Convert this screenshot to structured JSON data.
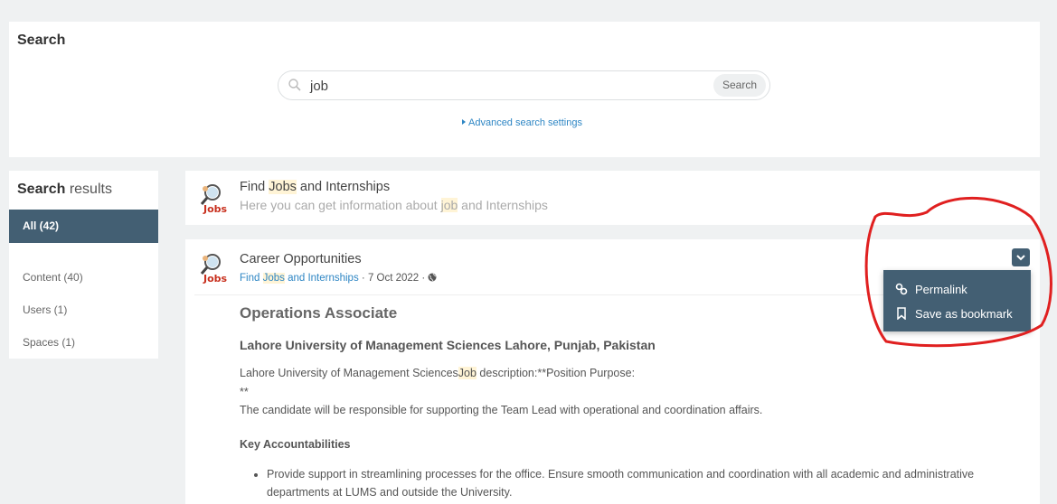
{
  "search": {
    "title": "Search",
    "query": "job",
    "button_label": "Search",
    "advanced_link": "Advanced search settings"
  },
  "sidebar": {
    "title_bold": "Search",
    "title_rest": " results",
    "active_filter": "All (42)",
    "filters": [
      "Content (40)",
      "Users (1)",
      "Spaces (1)"
    ]
  },
  "results": [
    {
      "title_pre": "Find ",
      "title_hl": "Jobs",
      "title_post": " and Internships",
      "sub_pre": "Here you can get information about ",
      "sub_hl": "job",
      "sub_post": " and Internships"
    },
    {
      "title": "Career Opportunities",
      "space_pre": "Find ",
      "space_hl": "Jobs",
      "space_post": " and Internships",
      "date": " · 7 Oct 2022 · ",
      "content": {
        "heading": "Operations Associate",
        "subheading": "Lahore University of Management Sciences Lahore, Punjab, Pakistan",
        "para1_pre": "Lahore University of Management Sciences",
        "para1_hl": "Job",
        "para1_post": " description:**Position Purpose:",
        "para2": "**",
        "para3": "The candidate will be responsible for supporting the Team Lead with operational and coordination affairs.",
        "section": "Key Accountabilities",
        "bullet1": "Provide support in streamlining processes for the office. Ensure smooth communication and coordination with all academic and administrative departments at LUMS and outside the University."
      }
    }
  ],
  "dropdown": {
    "items": [
      "Permalink",
      "Save as bookmark"
    ]
  },
  "colors": {
    "accent": "#435f73",
    "link": "#2e86c4",
    "highlight": "#fff4d6",
    "annotation": "#e02020"
  }
}
